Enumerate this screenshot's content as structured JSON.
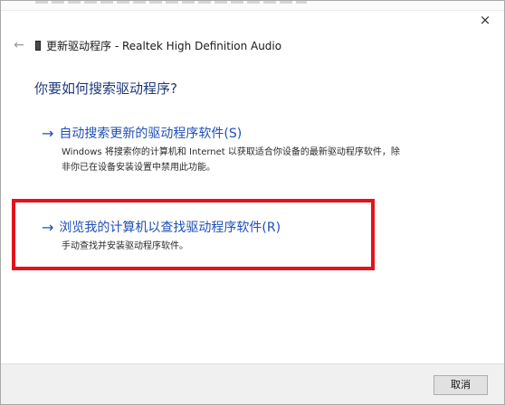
{
  "window": {
    "title": "更新驱动程序 - Realtek High Definition Audio",
    "close_icon": "×",
    "back_icon": "←"
  },
  "main": {
    "question": "你要如何搜索驱动程序?",
    "options": [
      {
        "arrow": "→",
        "title": "自动搜索更新的驱动程序软件(S)",
        "description": "Windows 将搜索你的计算机和 Internet 以获取适合你设备的最新驱动程序软件，除非你已在设备安装设置中禁用此功能。"
      },
      {
        "arrow": "→",
        "title": "浏览我的计算机以查找驱动程序软件(R)",
        "description": "手动查找并安装驱动程序软件。"
      }
    ]
  },
  "footer": {
    "cancel_label": "取消"
  },
  "colors": {
    "highlight_box": "#e4131a",
    "link_blue": "#1f4fb5",
    "heading_blue": "#1e3a78"
  }
}
